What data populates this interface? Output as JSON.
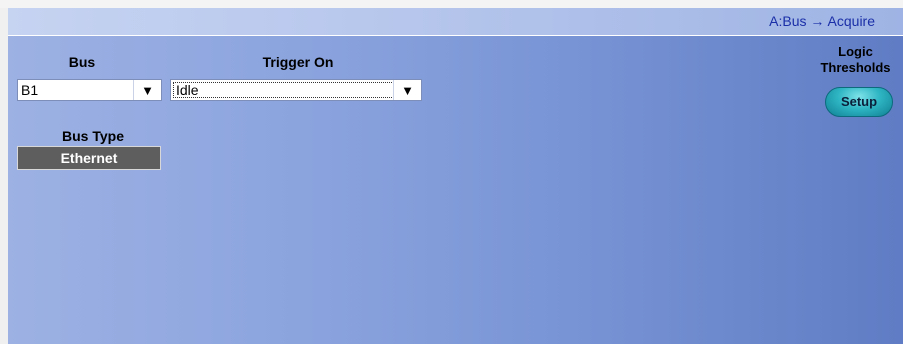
{
  "header": {
    "title": "A:Bus → Acquire"
  },
  "bus": {
    "label": "Bus",
    "value": "B1"
  },
  "trigger_on": {
    "label": "Trigger On",
    "value": "Idle"
  },
  "bus_type": {
    "label": "Bus Type",
    "value": "Ethernet"
  },
  "logic_thresholds": {
    "label_line1": "Logic",
    "label_line2": "Thresholds",
    "button": "Setup"
  },
  "icons": {
    "dropdown_arrow": "▼"
  }
}
